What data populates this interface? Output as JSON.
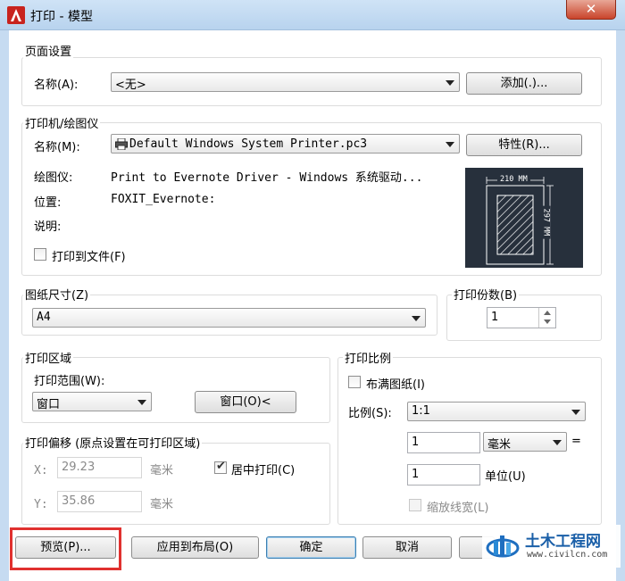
{
  "window": {
    "title": "打印 - 模型",
    "close_label": "✕"
  },
  "page_setup": {
    "group_label": "页面设置",
    "name_label": "名称(A):",
    "name_value": "<无>",
    "add_button": "添加(.)..."
  },
  "printer": {
    "group_label": "打印机/绘图仪",
    "name_label": "名称(M):",
    "name_value": "Default Windows System Printer.pc3",
    "properties_button": "特性(R)...",
    "plotter_label": "绘图仪:",
    "plotter_value": "Print to Evernote Driver - Windows 系统驱动...",
    "location_label": "位置:",
    "location_value": "FOXIT_Evernote:",
    "description_label": "说明:",
    "print_to_file_label": "打印到文件(F)",
    "print_to_file_checked": false,
    "preview_width": "210 MM",
    "preview_height": "297 MM"
  },
  "paper_size": {
    "group_label": "图纸尺寸(Z)",
    "value": "A4"
  },
  "copies": {
    "group_label": "打印份数(B)",
    "value": "1"
  },
  "plot_area": {
    "group_label": "打印区域",
    "range_label": "打印范围(W):",
    "range_value": "窗口",
    "window_button": "窗口(O)<"
  },
  "plot_scale": {
    "group_label": "打印比例",
    "fit_label": "布满图纸(I)",
    "fit_checked": false,
    "scale_label": "比例(S):",
    "scale_value": "1:1",
    "value1": "1",
    "unit1": "毫米",
    "equals": "=",
    "value2": "1",
    "unit2_label": "单位(U)",
    "scale_lineweights_label": "缩放线宽(L)",
    "scale_lineweights_checked": false
  },
  "plot_offset": {
    "group_label": "打印偏移 (原点设置在可打印区域)",
    "x_label": "X:",
    "x_value": "29.23",
    "x_unit": "毫米",
    "y_label": "Y:",
    "y_value": "35.86",
    "y_unit": "毫米",
    "center_label": "居中打印(C)",
    "center_checked": true
  },
  "footer": {
    "preview_button": "预览(P)...",
    "apply_layout_button": "应用到布局(O)",
    "ok_button": "确定",
    "cancel_button": "取消"
  },
  "watermark": {
    "text": "土木工程网",
    "url": "www.civilcn.com"
  },
  "colors": {
    "highlight": "#e0312f",
    "title_bar": "#c6dbf1",
    "close_button": "#c9442b",
    "preview_bg": "#27303c"
  }
}
